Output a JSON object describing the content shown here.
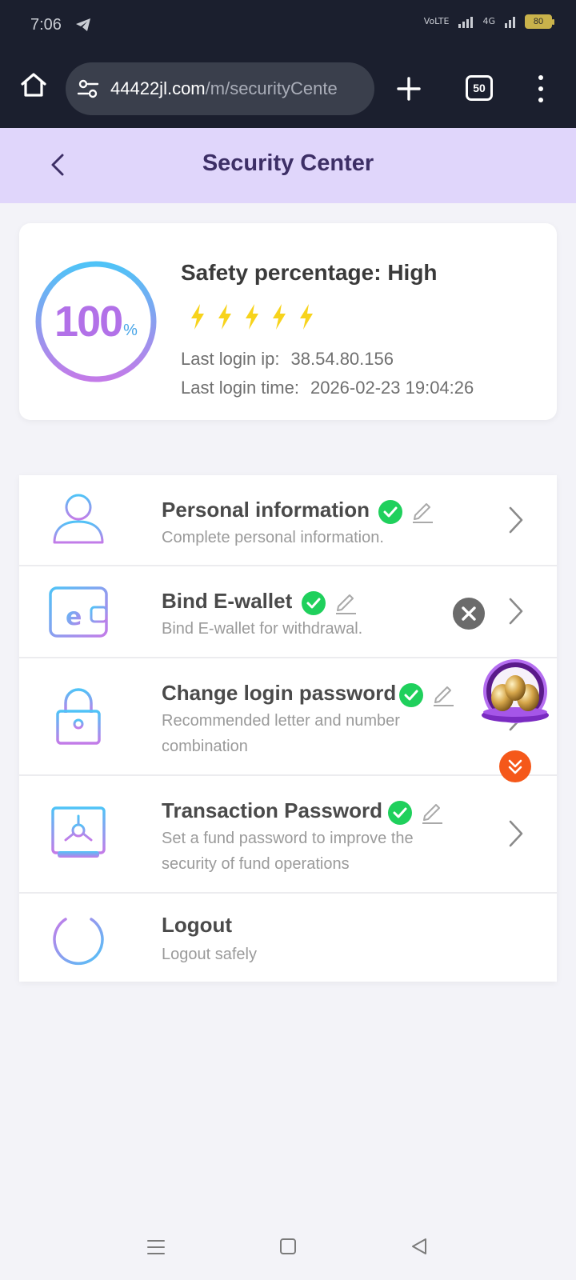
{
  "status_bar": {
    "time": "7:06",
    "signal_left": "VoLTE",
    "signal_right": "4G",
    "battery": "80"
  },
  "browser": {
    "url_host": "44422jl.com",
    "url_path": "/m/securityCente",
    "tab_count": "50"
  },
  "header": {
    "title": "Security Center"
  },
  "safety": {
    "percent_value": "100",
    "percent_unit": "%",
    "title": "Safety percentage: High",
    "level_bolts": 5,
    "last_ip_label": "Last login ip:",
    "last_ip_value": "38.54.80.156",
    "last_time_label": "Last login time:",
    "last_time_value": "2026-02-23 19:04:26"
  },
  "menu": {
    "items": [
      {
        "title": "Personal information",
        "desc": "Complete personal information.",
        "verified": true
      },
      {
        "title": "Bind E-wallet",
        "desc": "Bind E-wallet for withdrawal.",
        "verified": true
      },
      {
        "title": "Change login password",
        "desc": "Recommended letter and number combination",
        "verified": true
      },
      {
        "title": "Transaction Password",
        "desc": "Set a fund password to improve the security of fund operations",
        "verified": true
      },
      {
        "title": "Logout",
        "desc": "Logout safely"
      }
    ]
  },
  "colors": {
    "header_bg": "#e0d6fb",
    "title_color": "#3d2f66",
    "check_green": "#1fd05c",
    "bolt_yellow": "#f7d31c",
    "ring_start": "#4fc3f7",
    "ring_end": "#c37be8"
  }
}
